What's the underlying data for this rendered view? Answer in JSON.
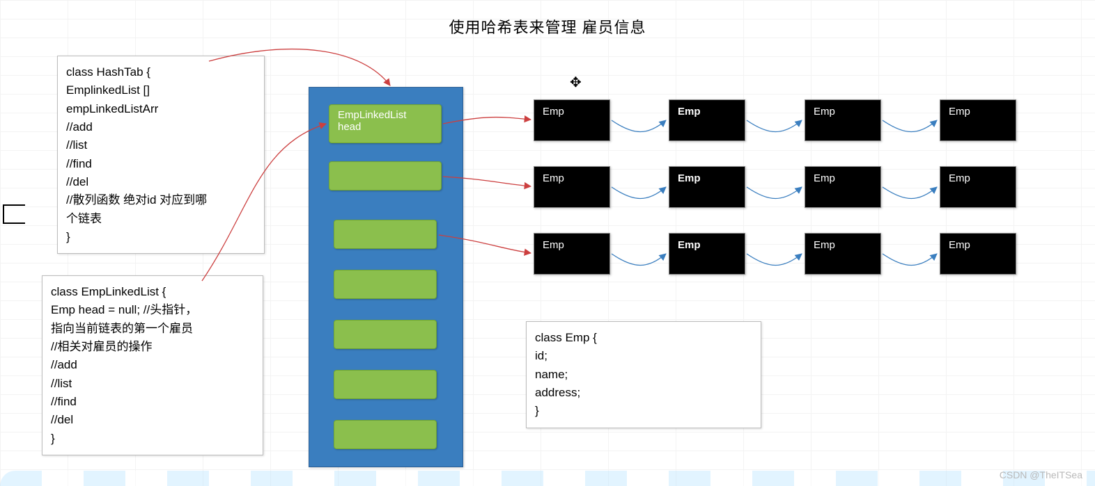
{
  "title": "使用哈希表来管理 雇员信息",
  "hashtab_box": {
    "l1": "class HashTab  {",
    "l2": "  EmplinkedList []",
    "l3": "empLinkedListArr",
    "l4": "  //add",
    "l5": "  //list",
    "l6": " //find",
    "l7": " //del",
    "l8": " //散列函数 绝对id 对应到哪",
    "l9": "  个链表",
    "l10": " }"
  },
  "linkedlist_box": {
    "l1": " class  EmpLinkedList {",
    "l2": "   Emp head = null; //头指针，",
    "l3": "  指向当前链表的第一个雇员",
    "l4": "  //相关对雇员的操作",
    "l5": " //add",
    "l6": " //list",
    "l7": " //find",
    "l8": " //del",
    "l9": " }"
  },
  "emp_box": {
    "l1": "class Emp {",
    "l2": "  id;",
    "l3": "   name;",
    "l4": "   address;",
    "l5": "  }"
  },
  "bucket_head": {
    "l1": "EmpLinkedList",
    "l2": "head"
  },
  "emp_label": "Emp",
  "watermark": "CSDN @TheITSea"
}
